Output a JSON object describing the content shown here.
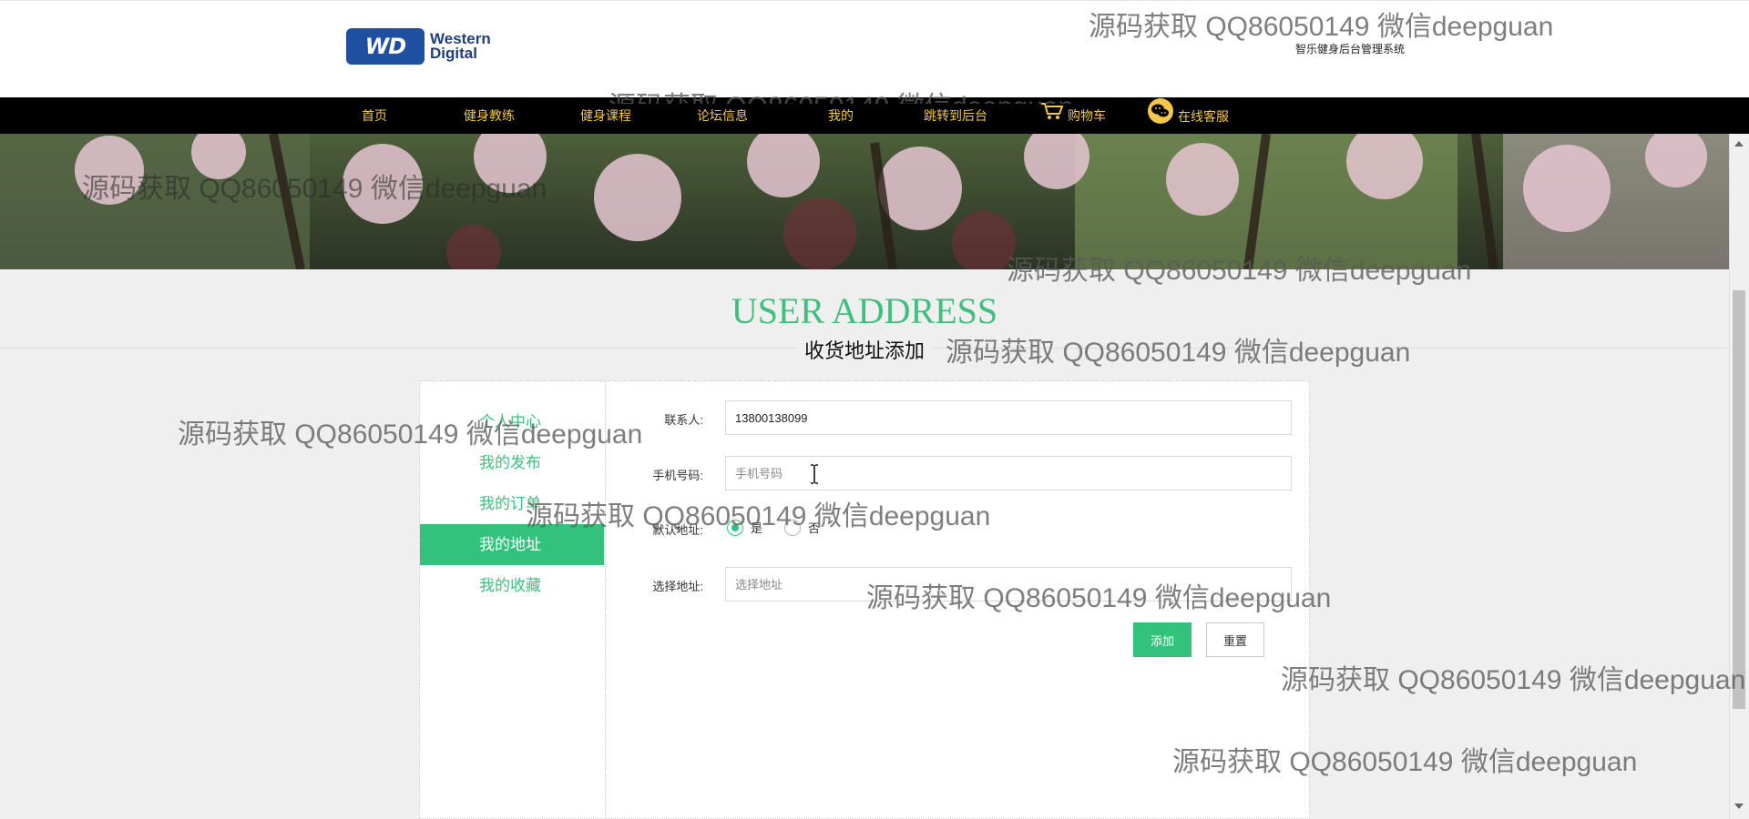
{
  "header": {
    "logo_line1": "Western",
    "logo_line2": "Digital",
    "logo_mark": "WD",
    "system_name": "智乐健身后台管理系统"
  },
  "nav": {
    "items": [
      {
        "label": "首页"
      },
      {
        "label": "健身教练"
      },
      {
        "label": "健身课程"
      },
      {
        "label": "论坛信息"
      },
      {
        "label": "我的"
      },
      {
        "label": "跳转到后台"
      },
      {
        "label": "购物车",
        "icon": "cart-icon"
      },
      {
        "label": "在线客服",
        "icon": "wechat-icon"
      }
    ]
  },
  "title": {
    "main": "USER ADDRESS",
    "sub": "收货地址添加"
  },
  "sidebar": {
    "items": [
      {
        "label": "个人中心"
      },
      {
        "label": "我的发布"
      },
      {
        "label": "我的订单"
      },
      {
        "label": "我的地址",
        "active": true
      },
      {
        "label": "我的收藏"
      }
    ]
  },
  "form": {
    "contact": {
      "label": "联系人:",
      "value": "13800138099"
    },
    "phone": {
      "label": "手机号码:",
      "placeholder": "手机号码"
    },
    "default": {
      "label": "默认地址:",
      "options": [
        "是",
        "否"
      ],
      "selected": "是"
    },
    "address": {
      "label": "选择地址:",
      "placeholder": "选择地址"
    },
    "add_label": "添加",
    "reset_label": "重置"
  },
  "watermark": "源码获取 QQ86050149 微信deepguan",
  "colors": {
    "accent": "#32c27c",
    "nav_bg": "#000000",
    "nav_text": "#f4c74a",
    "title": "#3fbf7f"
  }
}
